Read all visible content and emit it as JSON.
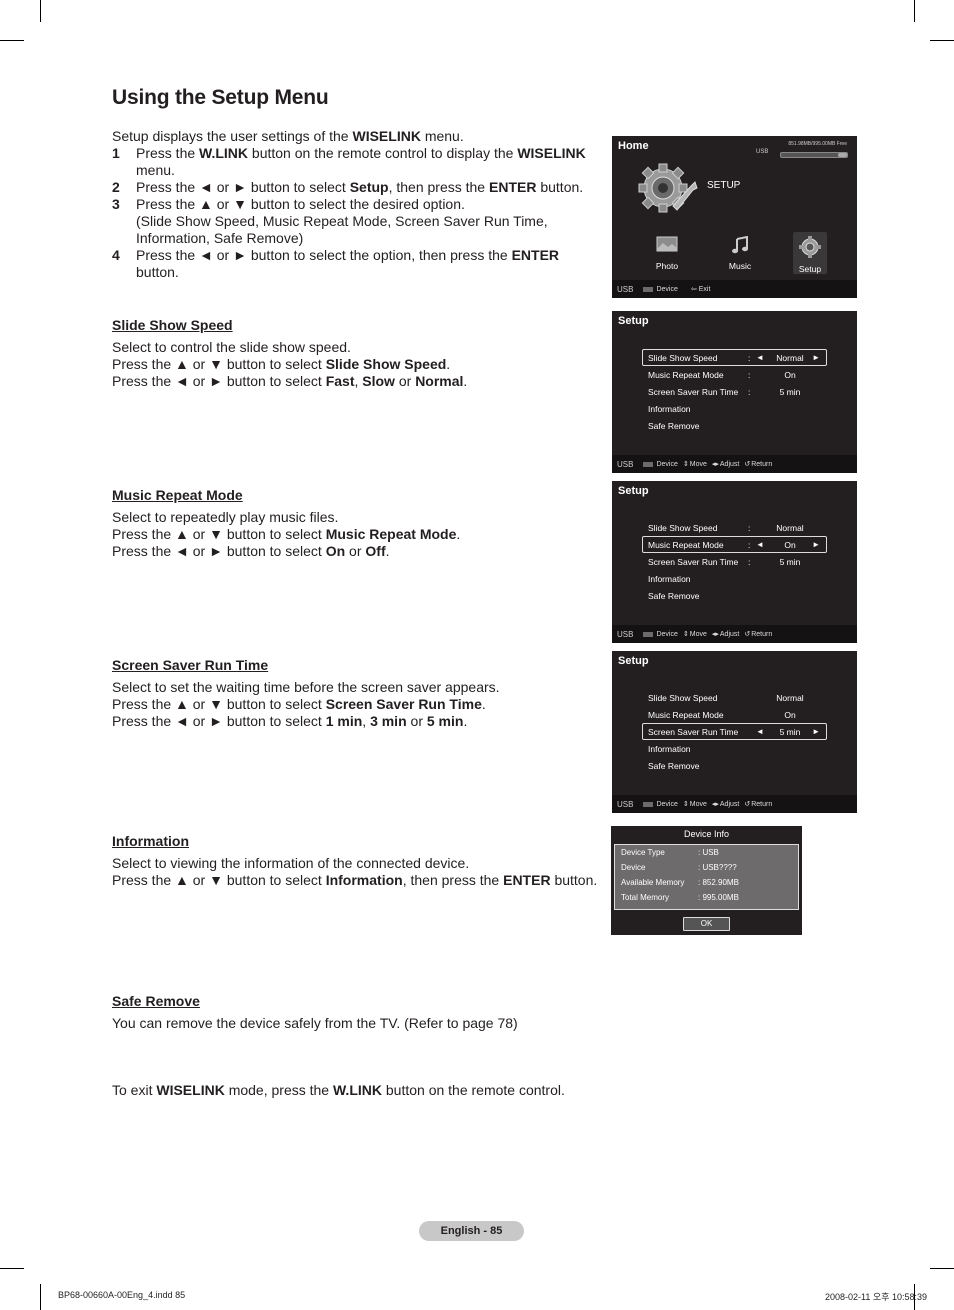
{
  "page_title": "Using the Setup Menu",
  "intro": {
    "line": [
      "Setup displays the user settings of the ",
      "WISELINK",
      " menu."
    ],
    "steps": [
      {
        "num": "1",
        "parts": [
          "Press the ",
          "W.LINK",
          " button on the remote control to display the ",
          "WISELINK",
          " menu."
        ]
      },
      {
        "num": "2",
        "parts": [
          "Press the ◄ or ► button to select ",
          "Setup",
          ", then press the ",
          "ENTER",
          " button."
        ]
      },
      {
        "num": "3",
        "parts": [
          "Press the ▲ or ▼ button to select the desired option.",
          "(Slide Show Speed, Music Repeat Mode, Screen Saver Run Time, Information, Safe Remove)"
        ]
      },
      {
        "num": "4",
        "parts": [
          "Press the ◄ or ► button to select the option, then press the ",
          "ENTER",
          " button."
        ]
      }
    ]
  },
  "sections": {
    "slide": {
      "heading": "Slide Show Speed",
      "l1": "Select to control the slide show speed.",
      "l2": [
        "Press the ▲ or ▼ button to select ",
        "Slide Show Speed",
        "."
      ],
      "l3": [
        "Press the ◄ or ► button to select ",
        "Fast",
        ", ",
        "Slow",
        " or ",
        "Normal",
        "."
      ]
    },
    "music": {
      "heading": "Music Repeat Mode",
      "l1": "Select to repeatedly play music files.",
      "l2": [
        "Press the ▲ or ▼ button to select ",
        "Music Repeat Mode",
        "."
      ],
      "l3": [
        "Press the ◄ or ► button to select ",
        "On",
        " or ",
        "Off",
        "."
      ]
    },
    "saver": {
      "heading": "Screen Saver Run Time",
      "l1": "Select to set the waiting time before the screen saver appears.",
      "l2": [
        "Press the ▲ or ▼ button to select ",
        "Screen Saver Run Time",
        "."
      ],
      "l3": [
        "Press the ◄ or ► button to select ",
        "1 min",
        ", ",
        "3 min",
        " or ",
        "5 min",
        "."
      ]
    },
    "info": {
      "heading": "Information",
      "l1": "Select to viewing the information of the connected device.",
      "l2": [
        "Press the ▲ or ▼ button to select ",
        "Information",
        ", then press the ",
        "ENTER",
        " button."
      ]
    },
    "safe": {
      "heading": "Safe Remove",
      "l1": "You can remove the device safely from the TV. (Refer to page 78)"
    }
  },
  "exit_line": [
    "To exit ",
    "WISELINK",
    " mode, press the ",
    "W.LINK",
    " button on the remote control."
  ],
  "home_screen": {
    "title": "Home",
    "usb_label": "USB",
    "usb_free": "851.98MB/995.00MB Free",
    "usb_used_fraction": 0.14,
    "big_label": "SETUP",
    "items": [
      {
        "label": "Photo",
        "icon": "photo-icon"
      },
      {
        "label": "Music",
        "icon": "music-note-icon"
      },
      {
        "label": "Setup",
        "icon": "gear-icon"
      }
    ],
    "footer": {
      "source": "USB",
      "device": "Device",
      "exit": "Exit"
    }
  },
  "setup_screen": {
    "title": "Setup",
    "labels": [
      "Slide Show Speed",
      "Music Repeat Mode",
      "Screen Saver Run Time",
      "Information",
      "Safe Remove"
    ],
    "values": [
      "Normal",
      "On",
      "5 min"
    ],
    "colon": ":",
    "left_arrow": "◄",
    "right_arrow": "►",
    "footer": {
      "source": "USB",
      "device": "Device",
      "move": "Move",
      "adjust": "Adjust",
      "return": "Return"
    }
  },
  "device_info": {
    "title": "Device Info",
    "rows": [
      {
        "k": "Device Type",
        "v": ": USB"
      },
      {
        "k": "Device",
        "v": ": USB????"
      },
      {
        "k": "Available Memory",
        "v": ": 852.90MB"
      },
      {
        "k": "Total Memory",
        "v": ": 995.00MB"
      }
    ],
    "ok": "OK"
  },
  "page_number": "English - 85",
  "slug_left": "BP68-00660A-00Eng_4.indd   85",
  "slug_right": "2008-02-11   오후 10:58:39"
}
